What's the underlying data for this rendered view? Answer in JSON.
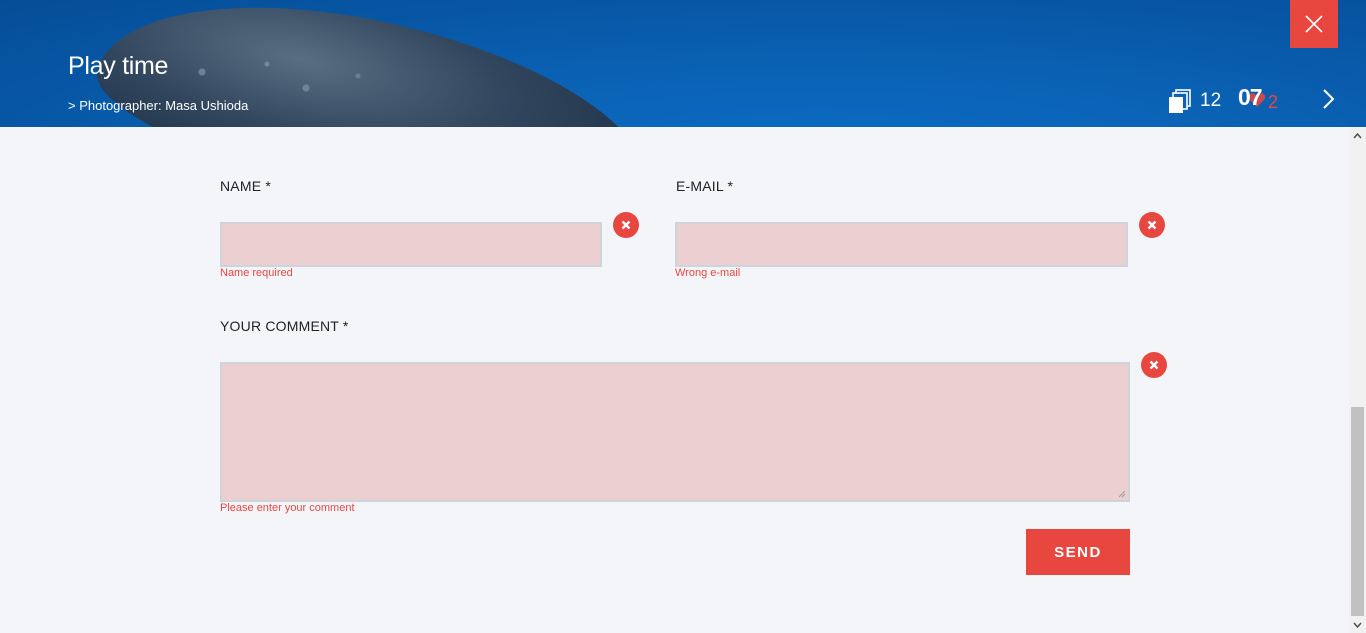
{
  "header": {
    "title": "Play time",
    "credit": "> Photographer: Masa Ushioda",
    "gallery_count": "12",
    "date_day": "07",
    "date_month": "2"
  },
  "form": {
    "name_label": "NAME *",
    "name_error": "Name required",
    "email_label": "E-MAIL *",
    "email_error": "Wrong e-mail",
    "comment_label": "YOUR COMMENT *",
    "comment_error": "Please enter your comment",
    "send_label": "SEND"
  },
  "colors": {
    "accent": "#e8473f",
    "error_field_bg": "#ebcfd1",
    "page_bg": "#f3f5f9",
    "header_blue": "#0b63b6"
  },
  "icons": [
    "close-icon",
    "gallery-stack-icon",
    "heart-icon",
    "chevron-right-icon",
    "error-x-icon",
    "resize-grip-icon"
  ]
}
